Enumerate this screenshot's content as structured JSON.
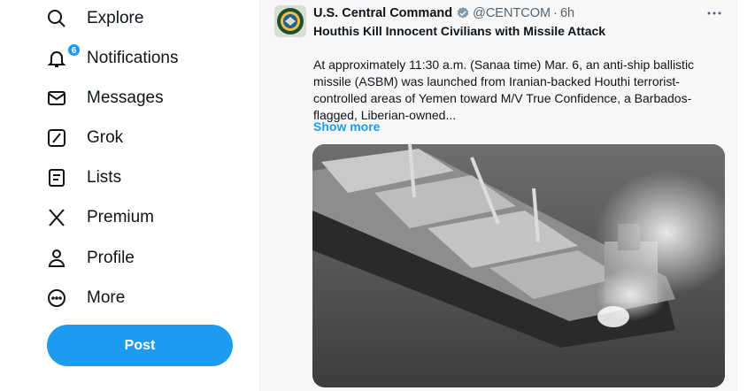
{
  "sidebar": {
    "items": [
      {
        "label": "Explore",
        "icon": "search-icon"
      },
      {
        "label": "Notifications",
        "icon": "bell-icon",
        "badge": "6"
      },
      {
        "label": "Messages",
        "icon": "envelope-icon"
      },
      {
        "label": "Grok",
        "icon": "grok-icon"
      },
      {
        "label": "Lists",
        "icon": "list-icon"
      },
      {
        "label": "Premium",
        "icon": "x-logo-icon"
      },
      {
        "label": "Profile",
        "icon": "person-icon"
      },
      {
        "label": "More",
        "icon": "more-circle-icon"
      }
    ],
    "post_label": "Post"
  },
  "tweet": {
    "author": "U.S. Central Command",
    "handle": "@CENTCOM",
    "separator": "·",
    "time": "6h",
    "title": "Houthis Kill Innocent Civilians with Missile Attack",
    "body": "At approximately 11:30 a.m. (Sanaa time) Mar. 6, an anti-ship ballistic\nmissile (ASBM) was launched from Iranian-backed Houthi terrorist-\ncontrolled areas of Yemen toward M/V True Confidence, a Barbados-\nflagged, Liberian-owned...",
    "show_more": "Show more",
    "media_description_icon": "ship-photo"
  },
  "colors": {
    "accent": "#1d9bf0",
    "text": "#0f1419",
    "secondary_text": "#536471",
    "feed_bg": "#f7f7f7"
  }
}
